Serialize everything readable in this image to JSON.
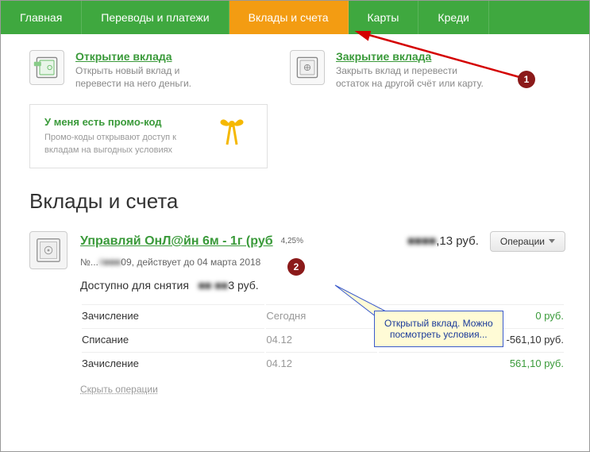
{
  "nav": {
    "items": [
      "Главная",
      "Переводы и платежи",
      "Вклады и счета",
      "Карты",
      "Креди"
    ]
  },
  "actions": {
    "open": {
      "title": "Открытие вклада",
      "desc": "Открыть новый вклад и перевести на него деньги."
    },
    "close": {
      "title": "Закрытие вклада",
      "desc": "Закрыть вклад и перевести остаток на другой счёт или карту."
    }
  },
  "promo": {
    "title": "У меня есть промо-код",
    "desc": "Промо-коды открывают доступ к вкладам на выгодных условиях"
  },
  "page_title": "Вклады и счета",
  "deposit": {
    "name": "Управляй ОнЛ@йн 6м - 1г (руб",
    "rate": "4,25%",
    "balance_hidden": "■■■■",
    "balance_suffix": ",13 руб.",
    "ops_button": "Операции",
    "number_prefix": "№...",
    "number_hidden": "4■■■",
    "number_suffix": "09, действует до 04 марта 2018",
    "available_label": "Доступно для снятия",
    "available_hidden": "■■ ■■",
    "available_suffix": "3 руб.",
    "transactions": [
      {
        "label": "Зачисление",
        "date": "Сегодня",
        "amount": "0 руб."
      },
      {
        "label": "Списание",
        "date": "04.12",
        "amount": "-561,10 руб."
      },
      {
        "label": "Зачисление",
        "date": "04.12",
        "amount": "561,10 руб."
      }
    ],
    "hide_link": "Скрыть операции"
  },
  "annotations": {
    "marker1": "1",
    "marker2": "2",
    "callout_line1": "Открытый вклад. Можно",
    "callout_line2": "посмотреть условия..."
  }
}
